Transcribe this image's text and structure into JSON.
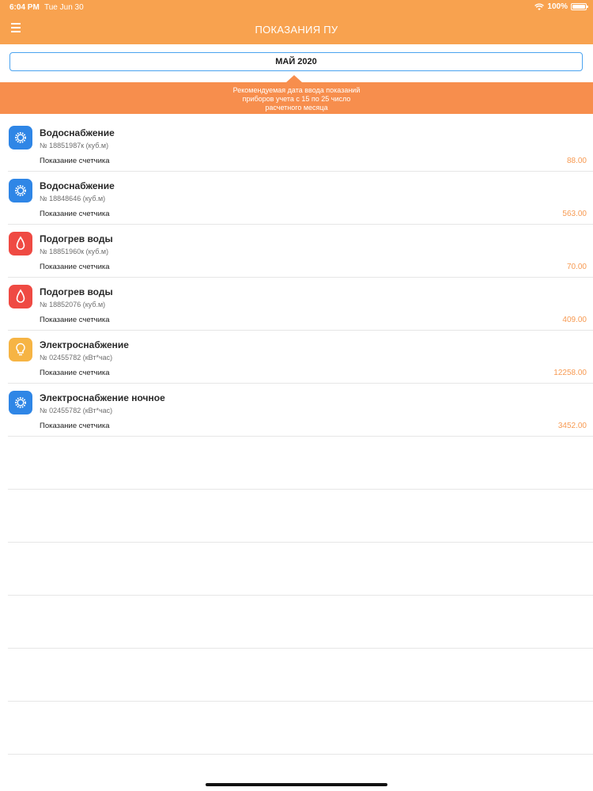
{
  "status": {
    "time": "6:04 PM",
    "date": "Tue Jun 30",
    "battery": "100%"
  },
  "nav": {
    "title": "ПОКАЗАНИЯ ПУ"
  },
  "month_selector": {
    "value": "МАЙ 2020"
  },
  "banner": {
    "line1": "Рекомендуемая дата ввода показаний",
    "line2": "приборов учета с 15 по 25 число",
    "line3": "расчетного месяца"
  },
  "meters": [
    {
      "title": "Водоснабжение",
      "serial": "№ 18851987к (куб.м)",
      "label": "Показание счетчика",
      "value": "88.00",
      "icon": "gear-icon",
      "color": "#2f86e6"
    },
    {
      "title": "Водоснабжение",
      "serial": "№ 18848646 (куб.м)",
      "label": "Показание счетчика",
      "value": "563.00",
      "icon": "gear-icon",
      "color": "#2f86e6"
    },
    {
      "title": "Подогрев воды",
      "serial": "№ 18851960к (куб.м)",
      "label": "Показание счетчика",
      "value": "70.00",
      "icon": "water-drop-icon",
      "color": "#ef4a43"
    },
    {
      "title": "Подогрев воды",
      "serial": "№ 18852076 (куб.м)",
      "label": "Показание счетчика",
      "value": "409.00",
      "icon": "water-drop-icon",
      "color": "#ef4a43"
    },
    {
      "title": "Электроснабжение",
      "serial": "№ 02455782 (кВт*час)",
      "label": "Показание счетчика",
      "value": "12258.00",
      "icon": "lightbulb-icon",
      "color": "#f6b444"
    },
    {
      "title": "Электроснабжение ночное",
      "serial": "№ 02455782 (кВт*час)",
      "label": "Показание счетчика",
      "value": "3452.00",
      "icon": "gear-icon",
      "color": "#2f86e6"
    }
  ],
  "colors": {
    "header": "#f8a24f",
    "banner": "#f78e4d",
    "value_text": "#f79a52",
    "select_border": "#4aa3f0"
  }
}
